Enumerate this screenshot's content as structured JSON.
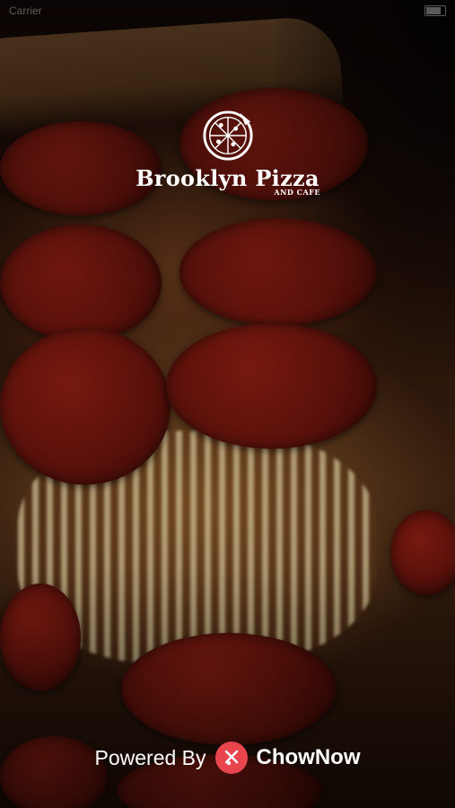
{
  "status_bar": {
    "carrier": "Carrier",
    "time": ""
  },
  "brand": {
    "name": "Brooklyn Pizza",
    "tagline": "AND CAFE"
  },
  "footer": {
    "powered_by": "Powered By",
    "provider": "ChowNow"
  },
  "icons": {
    "logo": "pizza-icon",
    "provider": "chownow-icon"
  },
  "colors": {
    "chownow_accent": "#e8454f",
    "text": "#ffffff"
  }
}
